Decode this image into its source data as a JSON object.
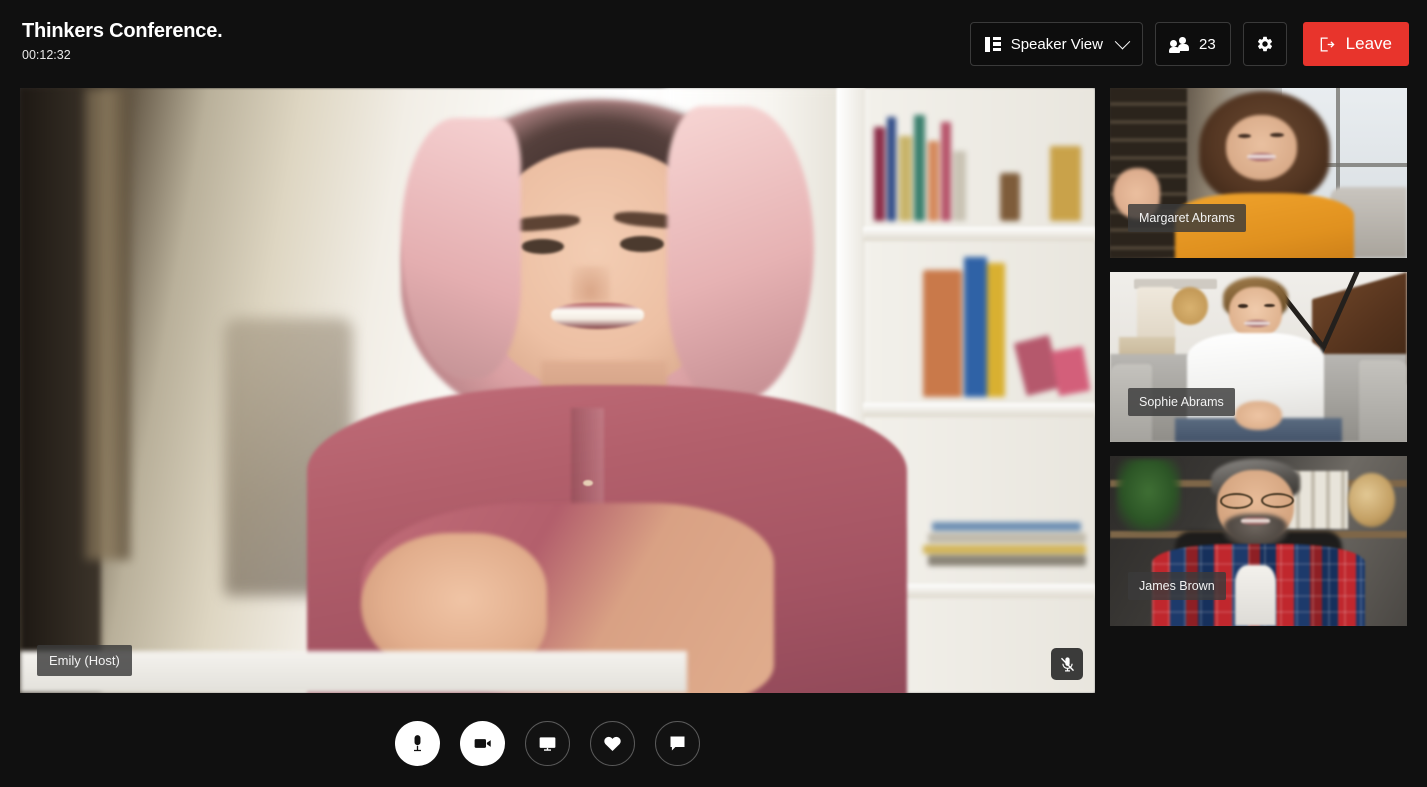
{
  "meeting": {
    "title": "Thinkers Conference.",
    "timer": "00:12:32"
  },
  "header": {
    "view_mode": {
      "label": "Speaker View",
      "icon": "layout-sidebar-icon",
      "chevron": "chevron-down-icon"
    },
    "participants": {
      "count": "23",
      "icon": "people-icon"
    },
    "settings": {
      "icon": "gear-icon",
      "label": ""
    },
    "leave": {
      "label": "Leave",
      "icon": "logout-icon",
      "color": "#E8342C"
    }
  },
  "stage": {
    "speaker_name": "Emily (Host)",
    "mic_status_icon": "mic-muted-icon"
  },
  "sidebar": {
    "participants": [
      {
        "name": "Margaret Abrams"
      },
      {
        "name": "Sophie Abrams"
      },
      {
        "name": "James Brown"
      }
    ]
  },
  "controls": [
    {
      "name": "microphone",
      "icon": "mic-icon",
      "state": "active",
      "label": ""
    },
    {
      "name": "camera",
      "icon": "video-camera-icon",
      "state": "active",
      "label": ""
    },
    {
      "name": "share-screen",
      "icon": "screen-share-icon",
      "state": "idle",
      "label": ""
    },
    {
      "name": "reactions",
      "icon": "heart-icon",
      "state": "idle",
      "label": ""
    },
    {
      "name": "chat",
      "icon": "chat-bubble-icon",
      "state": "idle",
      "label": ""
    }
  ],
  "theme": {
    "background": "#101010",
    "accent_danger": "#E8342C",
    "text_primary": "#ffffff"
  }
}
